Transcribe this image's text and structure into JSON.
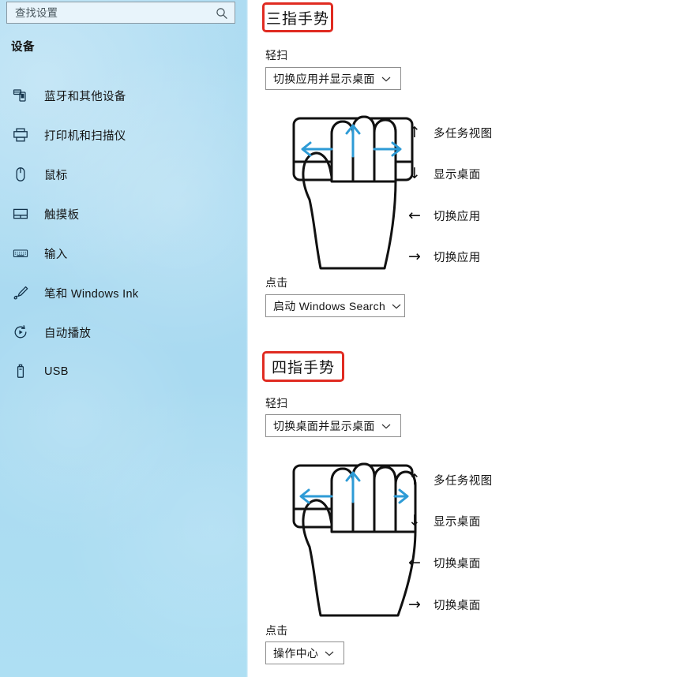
{
  "sidebar": {
    "search": {
      "placeholder": "查找设置",
      "value": "",
      "icon": "search-icon"
    },
    "header": "设备",
    "items": [
      {
        "label": "蓝牙和其他设备",
        "icon": "bluetooth-device-icon"
      },
      {
        "label": "打印机和扫描仪",
        "icon": "printer-icon"
      },
      {
        "label": "鼠标",
        "icon": "mouse-icon"
      },
      {
        "label": "触摸板",
        "icon": "touchpad-icon"
      },
      {
        "label": "输入",
        "icon": "keyboard-icon"
      },
      {
        "label": "笔和 Windows Ink",
        "icon": "pen-icon"
      },
      {
        "label": "自动播放",
        "icon": "autoplay-icon"
      },
      {
        "label": "USB",
        "icon": "usb-icon"
      }
    ]
  },
  "colors": {
    "sidebar_bg": "#abdcf2",
    "highlight_box": "#e02b21",
    "arrow_blue": "#2e9bd6",
    "text": "#141414"
  },
  "content": {
    "sections": [
      {
        "heading": "三指手势",
        "swipe_label": "轻扫",
        "swipe_value": "切换应用并显示桌面",
        "tap_label": "点击",
        "tap_value": "启动 Windows Search",
        "fingers": 3,
        "gestures": [
          {
            "arrow": "↑",
            "direction": "up",
            "label": "多任务视图"
          },
          {
            "arrow": "↓",
            "direction": "down",
            "label": "显示桌面"
          },
          {
            "arrow": "←",
            "direction": "left",
            "label": "切换应用"
          },
          {
            "arrow": "→",
            "direction": "right",
            "label": "切换应用"
          }
        ]
      },
      {
        "heading": "四指手势",
        "swipe_label": "轻扫",
        "swipe_value": "切换桌面并显示桌面",
        "tap_label": "点击",
        "tap_value": "操作中心",
        "fingers": 4,
        "gestures": [
          {
            "arrow": "↑",
            "direction": "up",
            "label": "多任务视图"
          },
          {
            "arrow": "↓",
            "direction": "down",
            "label": "显示桌面"
          },
          {
            "arrow": "←",
            "direction": "left",
            "label": "切换桌面"
          },
          {
            "arrow": "→",
            "direction": "right",
            "label": "切换桌面"
          }
        ]
      }
    ]
  }
}
